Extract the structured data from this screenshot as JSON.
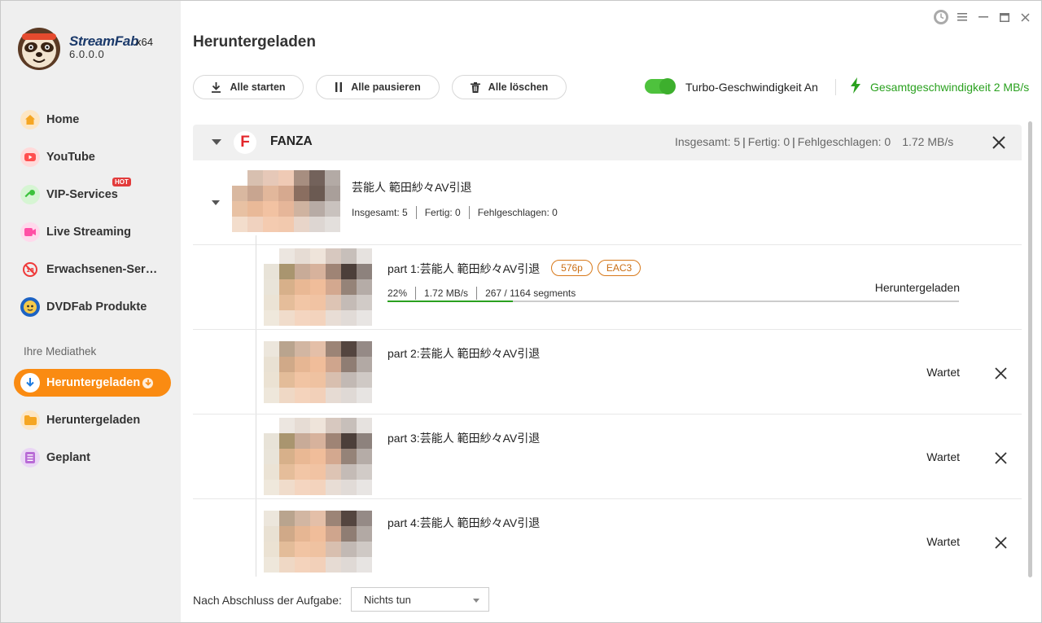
{
  "app": {
    "brand": "StreamFab",
    "arch": "x64",
    "version": "6.0.0.0"
  },
  "sidebar": {
    "items": [
      {
        "label": "Home",
        "icon": "home-icon",
        "color": "#f5a623"
      },
      {
        "label": "YouTube",
        "icon": "youtube-icon",
        "color": "#ff4f4f"
      },
      {
        "label": "VIP-Services",
        "icon": "key-icon",
        "color": "#3cc23c",
        "badge": "HOT"
      },
      {
        "label": "Live Streaming",
        "icon": "camera-icon",
        "color": "#ff4fa5"
      },
      {
        "label": "Erwachsenen-Ser…",
        "icon": "adult-icon",
        "color": "#ef3a3a"
      },
      {
        "label": "DVDFab Produkte",
        "icon": "dvdfab-icon",
        "color": "#1d63c3"
      }
    ],
    "library_label": "Ihre Mediathek",
    "library": [
      {
        "label": "Heruntergeladen",
        "icon": "download-icon",
        "active": true
      },
      {
        "label": "Heruntergeladen",
        "icon": "folder-icon",
        "color": "#f5a623"
      },
      {
        "label": "Geplant",
        "icon": "schedule-icon",
        "color": "#b86ad6"
      }
    ]
  },
  "header": {
    "title": "Heruntergeladen",
    "start_all": "Alle starten",
    "pause_all": "Alle pausieren",
    "delete_all": "Alle löschen",
    "turbo_label": "Turbo-Geschwindigkeit An",
    "total_speed": "Gesamtgeschwindigkeit 2 MB/s"
  },
  "group": {
    "name": "FANZA",
    "logo_letter": "F",
    "stats": {
      "total": "Insgesamt: 5",
      "done": "Fertig: 0",
      "failed": "Fehlgeschlagen: 0",
      "speed": "1.72 MB/s"
    },
    "subgroup": {
      "title": "芸能人 範田紗々AV引退",
      "total": "Insgesamt:  5",
      "done": "Fertig:  0",
      "failed": "Fehlgeschlagen: 0"
    },
    "parts": [
      {
        "title": "part 1:芸能人 範田紗々AV引退",
        "tag_res": "576p",
        "tag_audio": "EAC3",
        "percent": "22%",
        "speed": "1.72 MB/s",
        "segments": "267 / 1164 segments",
        "progress": 0.22,
        "status": "Heruntergeladen"
      },
      {
        "title": "part 2:芸能人 範田紗々AV引退",
        "status": "Wartet"
      },
      {
        "title": "part 3:芸能人 範田紗々AV引退",
        "status": "Wartet"
      },
      {
        "title": "part 4:芸能人 範田紗々AV引退",
        "status": "Wartet"
      }
    ]
  },
  "footer": {
    "label": "Nach Abschluss der Aufgabe:",
    "select_value": "Nichts tun"
  },
  "colors": {
    "accent": "#fa8b12",
    "speed_green": "#2aa11f",
    "tag_orange": "#d8791a"
  }
}
